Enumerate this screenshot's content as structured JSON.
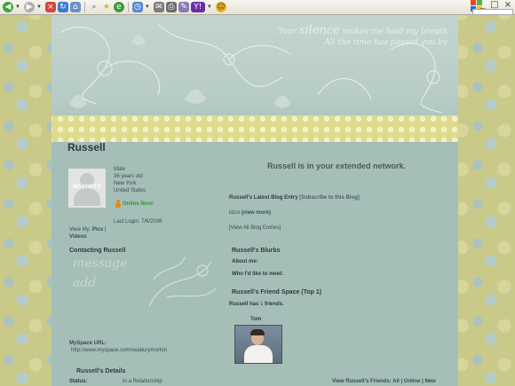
{
  "browser": {
    "toolbar_icons": [
      "back-icon",
      "forward-icon",
      "stop-icon",
      "refresh-icon",
      "home-icon",
      "search-icon",
      "favorites-icon",
      "media-icon",
      "history-icon",
      "mail-icon",
      "print-icon",
      "edit-icon",
      "yahoo-icon",
      "messenger-icon"
    ],
    "window_controls": [
      "_",
      "□",
      "×"
    ]
  },
  "profile": {
    "banner_quote_line1": "Your",
    "banner_quote_big": "silence",
    "banner_quote_line2": "makes me hold my breath",
    "banner_quote_line3": "All the time has passed you by",
    "name": "Russell",
    "photo_placeholder": "NO PHOTO",
    "gender": "Male",
    "age": "36 years old",
    "city": "New York",
    "country": "United States",
    "online_text": "Online Now!",
    "last_login": "Last Login: 7/6/2008",
    "view_my_prefix": "View My:",
    "view_my_pics": "Pics",
    "view_my_sep": "|",
    "view_my_videos": "Videos",
    "contacting_title": "Contacting Russell",
    "contact_word_message": "message",
    "contact_word_add": "add",
    "myspace_url_label": "MySpace URL:",
    "myspace_url": "http://www.myspace.com/seaburymorton",
    "details_title": "Russell's Details",
    "status_label": "Status:",
    "status_value": "In a Relationship"
  },
  "main": {
    "network_text": "Russell is in your extended network.",
    "blog_title": "Russell's Latest Blog Entry",
    "blog_subscribe": "[Subscribe to this Blog]",
    "blog_entry_text": "idzsi",
    "blog_view_more": "(view more)",
    "blog_view_all": "[View All Blog Entries]",
    "blurbs_title": "Russell's Blurbs",
    "about_me": "About me:",
    "who_meet": "Who I'd like to meet:",
    "friend_space_title": "Russell's Friend Space (Top 1)",
    "friends_count_prefix": "Russell has",
    "friends_count_value": "1",
    "friends_count_suffix": "friends.",
    "friend_name": "Tom",
    "view_friends": "View Russell's Friends: All | Online | New"
  }
}
